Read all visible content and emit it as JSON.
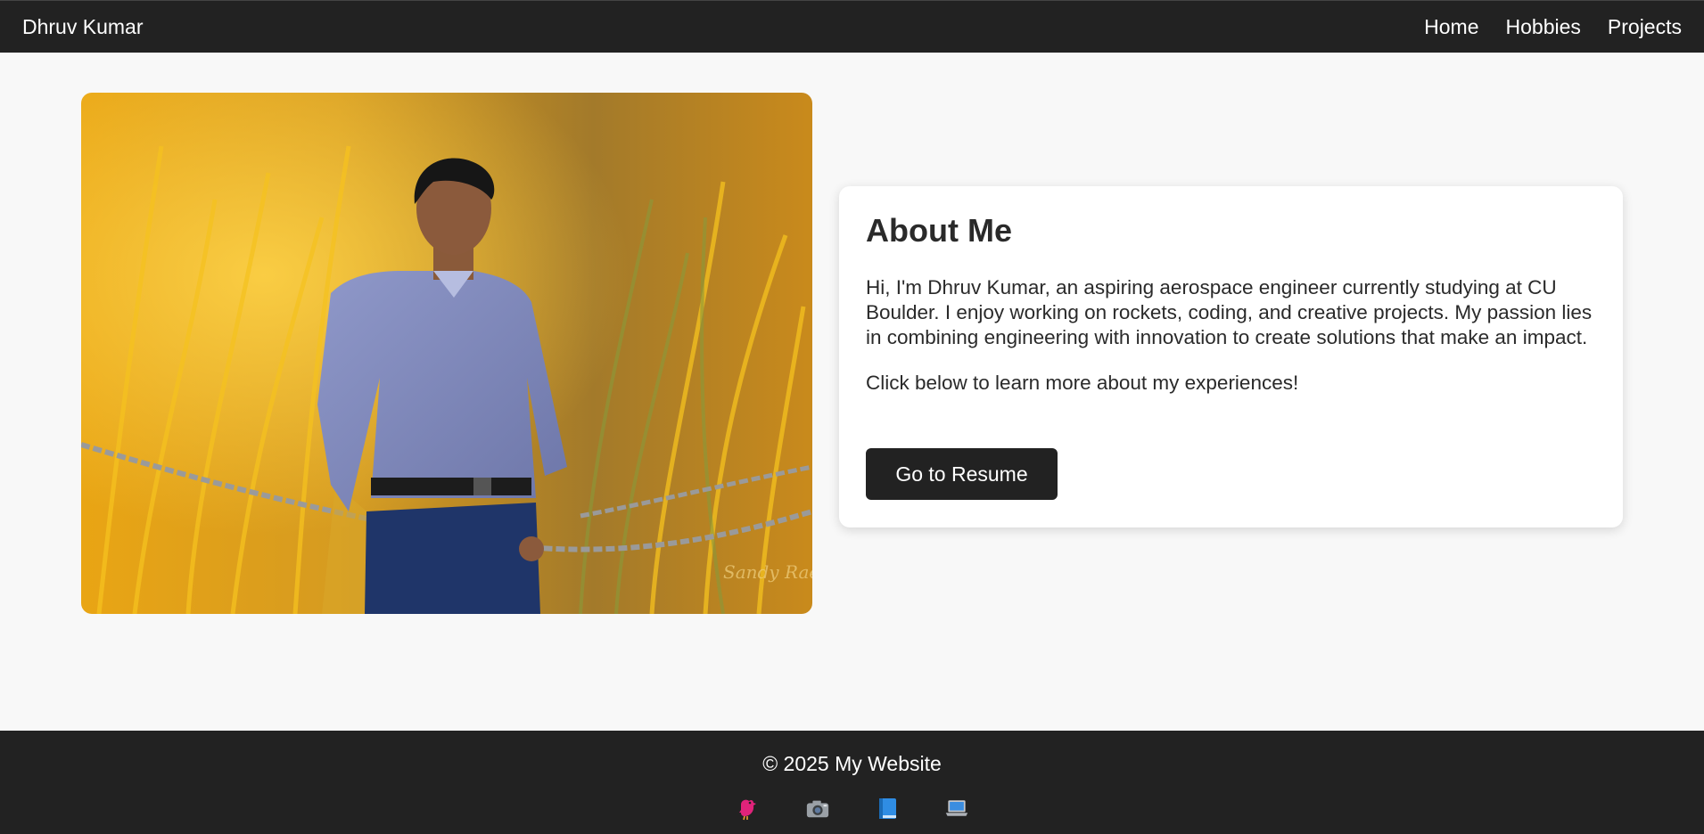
{
  "navbar": {
    "brand": "Dhruv Kumar",
    "links": [
      "Home",
      "Hobbies",
      "Projects"
    ]
  },
  "about": {
    "title": "About Me",
    "paragraph1": "Hi, I'm Dhruv Kumar, an aspiring aerospace engineer currently studying at CU Boulder. I enjoy working on rockets, coding, and creative projects. My passion lies in combining engineering with innovation to create solutions that make an impact.",
    "paragraph2": "Click below to learn more about my experiences!",
    "button_label": "Go to Resume"
  },
  "photo": {
    "icon": "profile-photo"
  },
  "footer": {
    "copyright": "© 2025 My Website",
    "socials": [
      {
        "icon": "bird-icon"
      },
      {
        "icon": "camera-icon"
      },
      {
        "icon": "book-icon"
      },
      {
        "icon": "laptop-icon"
      }
    ]
  },
  "colors": {
    "navbar_bg": "#222222",
    "page_bg": "#f8f8f8",
    "card_bg": "#ffffff",
    "button_bg": "#222222",
    "text": "#2a2a2a"
  }
}
